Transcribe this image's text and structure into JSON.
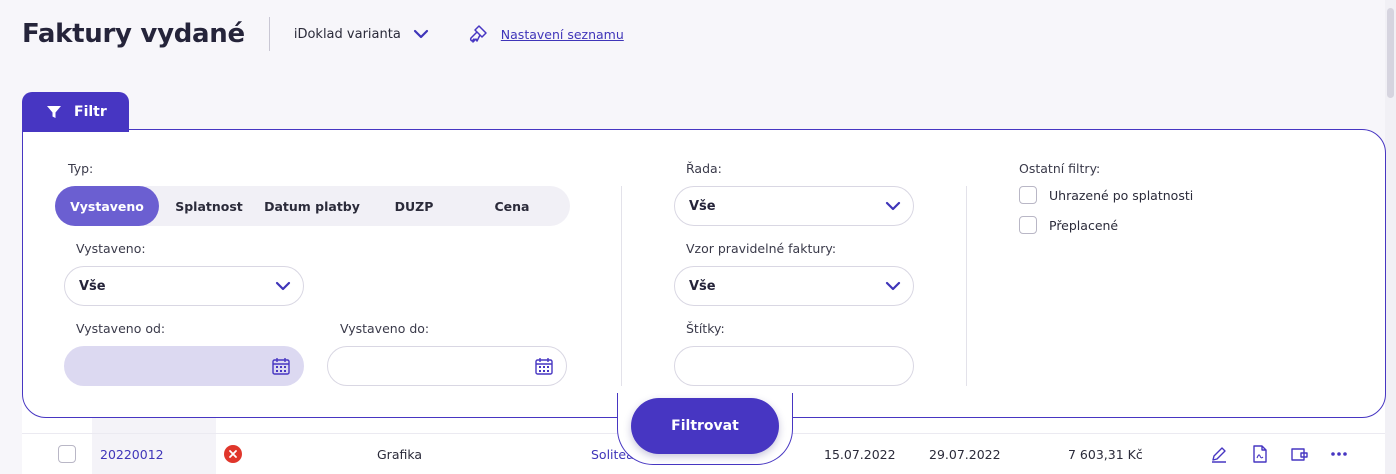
{
  "header": {
    "title": "Faktury vydané",
    "variant_label": "iDoklad varianta",
    "settings_link": "Nastavení seznamu"
  },
  "filter": {
    "tab_label": "Filtr",
    "type_label": "Typ:",
    "type_tabs": [
      "Vystaveno",
      "Splatnost",
      "Datum platby",
      "DUZP",
      "Cena"
    ],
    "issued_label": "Vystaveno:",
    "issued_value": "Vše",
    "issued_from_label": "Vystaveno od:",
    "issued_to_label": "Vystaveno do:",
    "series_label": "Řada:",
    "series_value": "Vše",
    "template_label": "Vzor pravidelné faktury:",
    "template_value": "Vše",
    "tags_label": "Štítky:",
    "other_label": "Ostatní filtry:",
    "other_options": [
      "Uhrazené po splatnosti",
      "Přeplacené"
    ],
    "submit_label": "Filtrovat"
  },
  "table": {
    "rows": [
      {
        "number": "20220012",
        "description": "Grafika",
        "partner": "Solitea",
        "issued": "15.07.2022",
        "due": "29.07.2022",
        "amount": "7 603,31 Kč"
      }
    ]
  },
  "colors": {
    "accent": "#4736c2",
    "active_segment": "#6b5fd1",
    "status_error": "#e0362b"
  }
}
